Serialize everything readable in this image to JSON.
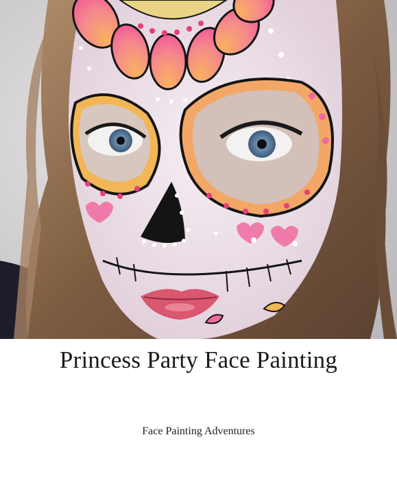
{
  "book": {
    "title": "Princess Party Face Painting",
    "author": "Face Painting Adventures"
  },
  "photo": {
    "subject": "sugar-skull-face-paint",
    "colors": {
      "background": "#d9d7d8",
      "hair": "#8a6a4e",
      "skin": "#efe3ea",
      "petal_pink": "#f26b9c",
      "petal_orange": "#f7a35a",
      "outline": "#141414",
      "lips": "#d9576f",
      "eyes": "#6f90b3"
    }
  }
}
